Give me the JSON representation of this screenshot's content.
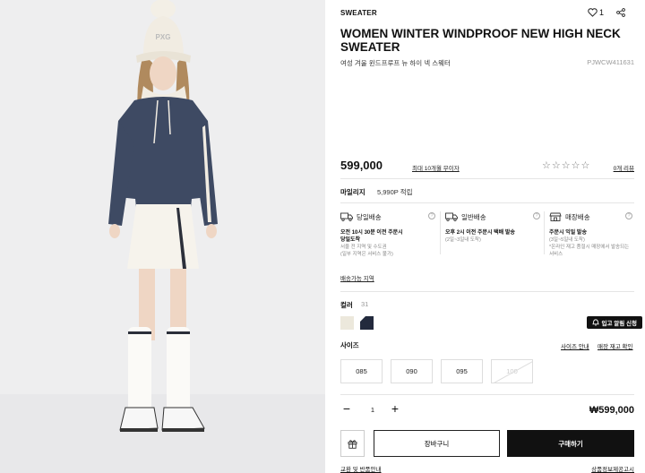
{
  "product": {
    "category": "SWEATER",
    "like_count": "1",
    "title": "WOMEN WINTER WINDPROOF NEW HIGH NECK SWEATER",
    "subtitle_ko": "여성 겨울 윈드프루프 뉴 하이 넥 스웨터",
    "code": "PJWCW411631",
    "price": "599,000",
    "installment": "최대 10개월 무이자",
    "review_count": "0개 리뷰",
    "rating_stars": 0
  },
  "mileage": {
    "label": "마일리지",
    "value": "5,990P 적립"
  },
  "delivery": [
    {
      "name": "당일배송",
      "line1": "오전 10시 30분 이전 주문시",
      "line2": "당일도착",
      "note": "서울 전 지역 및 수도권",
      "note2": "(일부 지역은 서비스 불가)"
    },
    {
      "name": "일반배송",
      "line1": "오후 2시 이전 주문시 택배 발송",
      "line2": "",
      "note": "(2일~3일내 도착)",
      "note2": ""
    },
    {
      "name": "매장배송",
      "line1": "주문시 익일 발송",
      "line2": "",
      "note": "(3일~5일내 도착)",
      "note2": "*온라인 재고 품절시 매장에서 발송되는 서비스"
    }
  ],
  "delivery_area_link": "배송가능 지역",
  "color": {
    "label": "컬러",
    "selected_code": "31",
    "swatches": [
      {
        "name": "cream",
        "hex": "#ece8dc"
      },
      {
        "name": "navy",
        "hex": "#232a3d"
      }
    ],
    "restock_button": "입고 알림 신청"
  },
  "size": {
    "label": "사이즈",
    "guide_link": "사이즈 안내",
    "stock_link": "매장 재고 확인",
    "options": [
      "085",
      "090",
      "095",
      "100"
    ],
    "soldout": [
      "100"
    ]
  },
  "quantity": {
    "minus": "−",
    "value": "1",
    "plus": "+"
  },
  "total": "₩599,000",
  "buttons": {
    "cart": "장바구니",
    "buy": "구매하기"
  },
  "footer_links": {
    "returns": "교환 및 반품안내",
    "notice": "상품정보제공고시"
  },
  "colors": {
    "accent": "#111111",
    "navy": "#232a3d",
    "cream": "#ece8dc"
  }
}
